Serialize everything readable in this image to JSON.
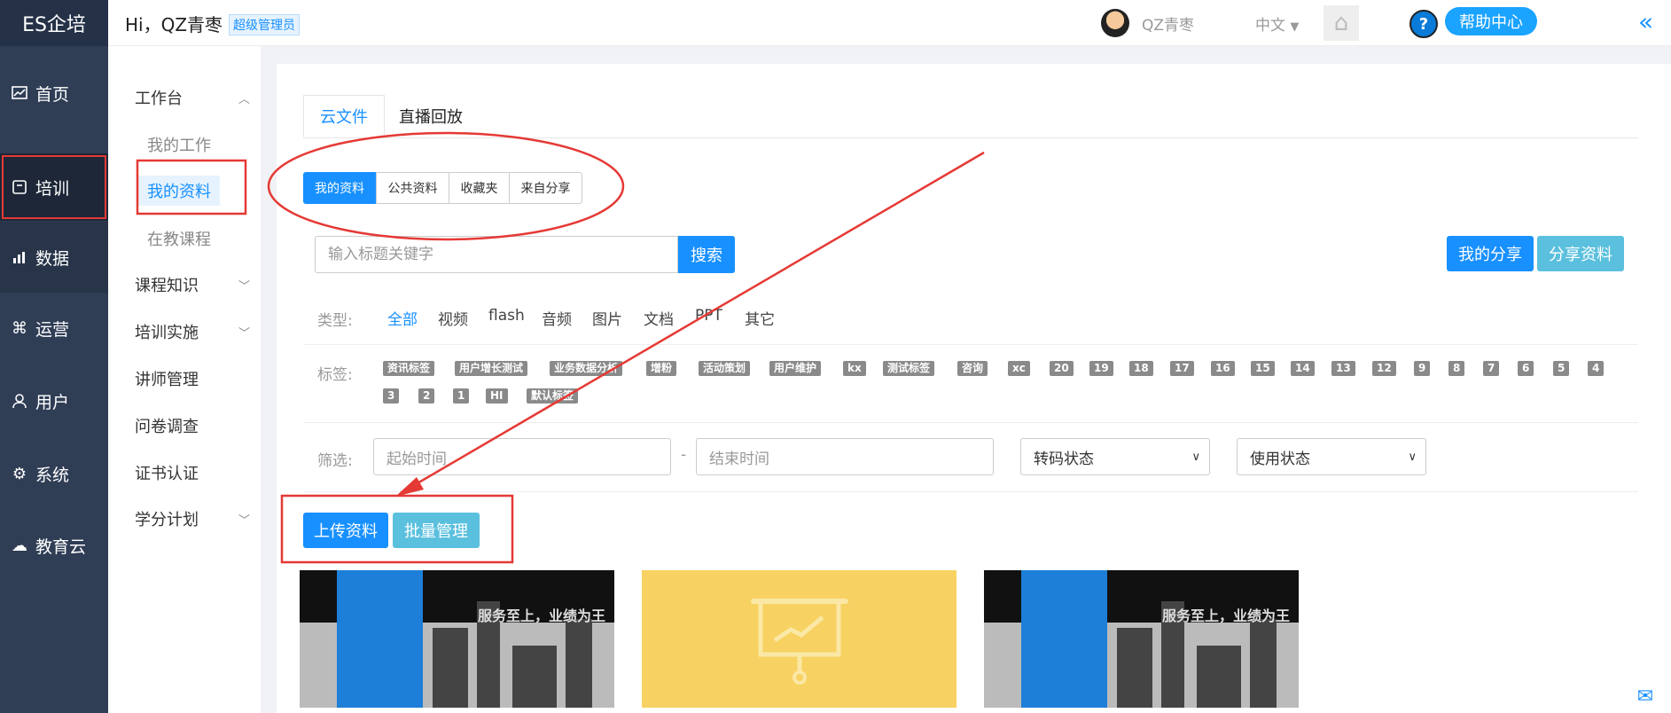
{
  "app": {
    "logo": "ES企培",
    "greeting": "Hi，QZ青枣",
    "role_badge": "超级管理员"
  },
  "topbar": {
    "username": "QZ青枣",
    "language": "中文",
    "help_label": "帮助中心"
  },
  "left_nav": [
    {
      "label": "首页",
      "icon": "chart-line-icon"
    },
    {
      "label": "培训",
      "icon": "book-icon"
    },
    {
      "label": "数据",
      "icon": "bar-chart-icon"
    },
    {
      "label": "运营",
      "icon": "command-icon"
    },
    {
      "label": "用户",
      "icon": "user-icon"
    },
    {
      "label": "系统",
      "icon": "gear-icon"
    },
    {
      "label": "教育云",
      "icon": "cloud-icon"
    }
  ],
  "sub_nav": {
    "workbench": "工作台",
    "my_work": "我的工作",
    "my_materials": "我的资料",
    "teaching_courses": "在教课程",
    "course_knowledge": "课程知识",
    "training_impl": "培训实施",
    "lecturer_mgmt": "讲师管理",
    "survey": "问卷调查",
    "certificate": "证书认证",
    "credit_plan": "学分计划"
  },
  "tabs": {
    "cloud_files": "云文件",
    "live_replay": "直播回放"
  },
  "segments": {
    "mine": "我的资料",
    "public": "公共资料",
    "favorites": "收藏夹",
    "shared": "来自分享"
  },
  "search": {
    "placeholder": "输入标题关键字",
    "button": "搜索"
  },
  "actions": {
    "my_share": "我的分享",
    "share_material": "分享资料",
    "upload": "上传资料",
    "batch": "批量管理"
  },
  "type_filter": {
    "label": "类型:",
    "options": [
      "全部",
      "视频",
      "flash",
      "音频",
      "图片",
      "文档",
      "PPT",
      "其它"
    ]
  },
  "tag_filter": {
    "label": "标签:",
    "tags": [
      "资讯标签",
      "用户增长测试",
      "业务数据分析",
      "增粉",
      "活动策划",
      "用户维护",
      "kx",
      "测试标签",
      "咨询",
      "xc",
      "20",
      "19",
      "18",
      "17",
      "16",
      "15",
      "14",
      "13",
      "12",
      "9",
      "8",
      "7",
      "6",
      "5",
      "4",
      "3",
      "2",
      "1",
      "HI",
      "默认标签"
    ]
  },
  "screen_filter": {
    "label": "筛选:",
    "start": "起始时间",
    "dash": "-",
    "end": "结束时间",
    "transcode": "转码状态",
    "usage": "使用状态"
  },
  "thumbs": {
    "caption1": "服务至上，业绩为王",
    "caption3": "服务至上，业绩为王"
  },
  "colors": {
    "accent": "#1890ff",
    "nav_bg": "#2f3d55",
    "annotation": "#e53935",
    "teal": "#5bc0de"
  }
}
